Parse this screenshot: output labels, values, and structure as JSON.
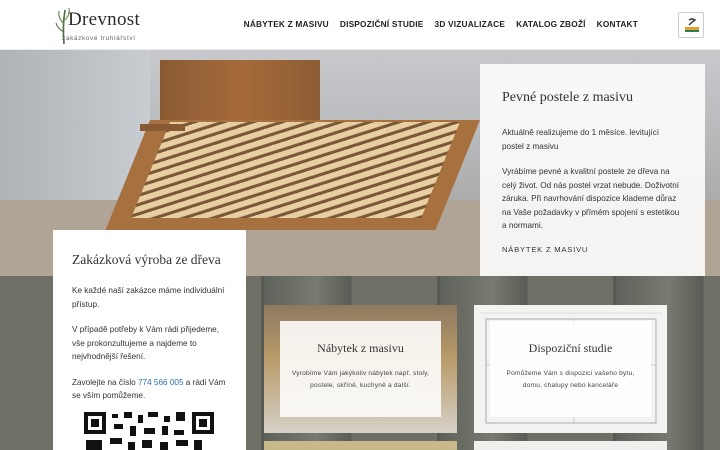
{
  "header": {
    "logo_text": "Drevnost",
    "logo_sub": "zakázkové truhlářství",
    "nav": [
      "NÁBYTEK Z MASIVU",
      "DISPOZIČNÍ STUDIE",
      "3D VIZUALIZACE",
      "KATALOG ZBOŽÍ",
      "KONTAKT"
    ]
  },
  "hero": {
    "title": "Pevné postele z masivu",
    "p1": "Aktuálně realizujeme do 1 měsíce. levitující postel z masivu",
    "p2": "Vyrábíme pevné a kvalitní postele ze dřeva na celý život. Od nás postel vrzat nebude. Doživotní záruka. Při navrhování dispozice klademe důraz na Vaše požadavky v přímém spojení s estetikou a normami.",
    "link": "NÁBYTEK Z MASIVU"
  },
  "left_card": {
    "title": "Zakázková výroba ze dřeva",
    "p1": "Ke každé naší zakázce máme individuální přístup.",
    "p2": "V případě potřeby k Vám rádi přijedeme, vše prokonzultujeme a najdeme to nejvhodnější řešení.",
    "p3_prefix": "Zavolejte na číslo ",
    "phone": "774 566 005",
    "p3_suffix": " a rádi Vám se vším pomůžeme."
  },
  "services": [
    {
      "title": "Nábytek z masivu",
      "text": "Vyrobíme Vám jakýkoliv nábytek např. stoly, postele, skříně, kuchyně a další."
    },
    {
      "title": "Dispoziční studie",
      "text": "Pomůžeme Vám s dispozicí vašeho bytu, domu, chalupy nebo kanceláře"
    }
  ],
  "colors": {
    "accent_link": "#2c6db5",
    "wood_dark": "#5f625a",
    "panel_bg": "#ffffff"
  }
}
